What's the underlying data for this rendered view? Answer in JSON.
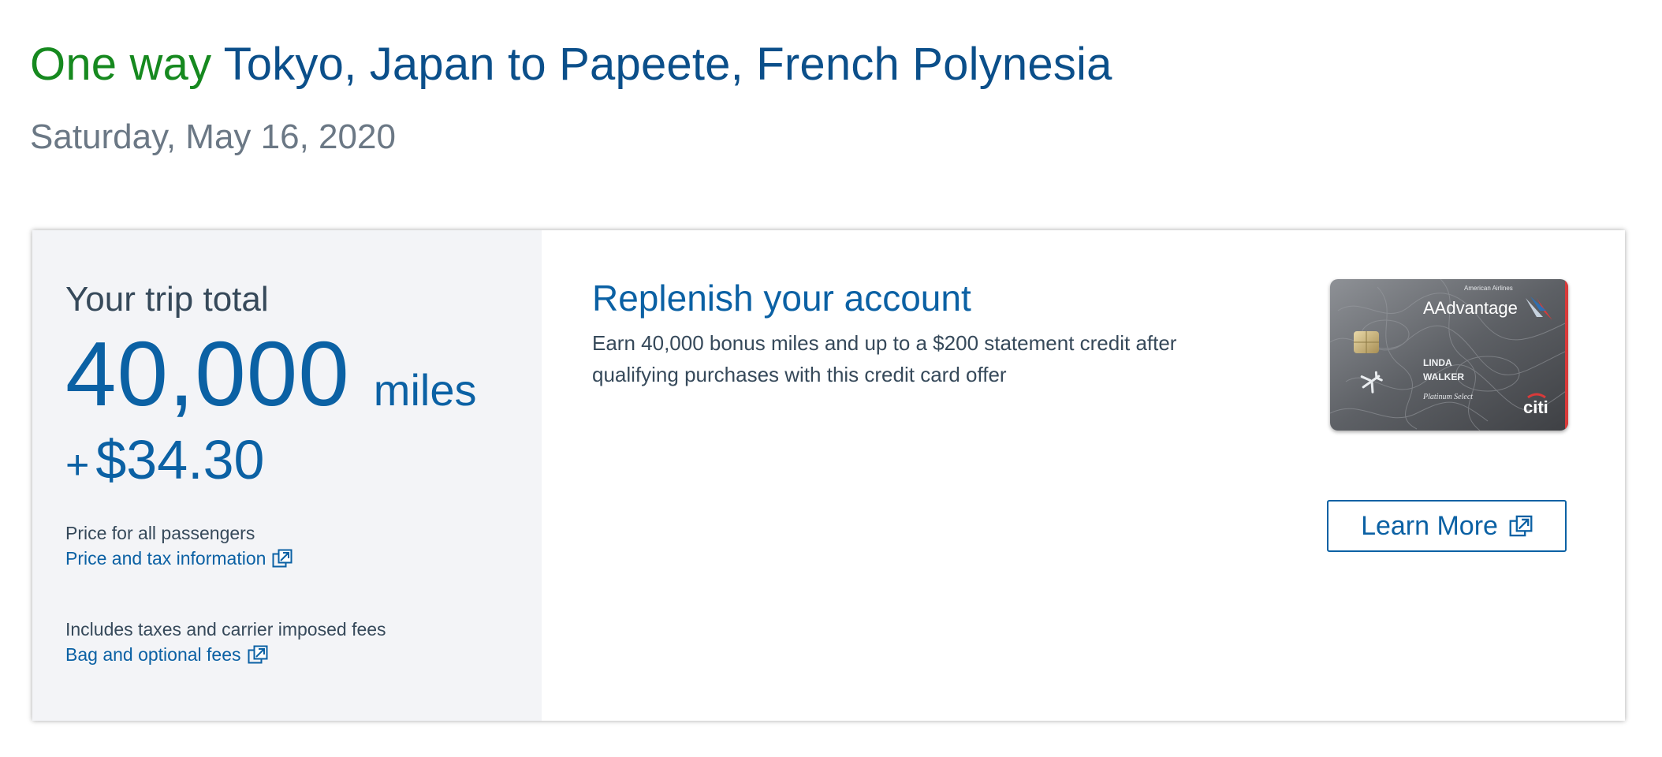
{
  "header": {
    "trip_type": "One way",
    "route": "Tokyo, Japan to Papeete, French Polynesia",
    "date": "Saturday, May 16, 2020"
  },
  "summary": {
    "label": "Your trip total",
    "miles_amount": "40,000",
    "miles_unit": "miles",
    "cash_plus": "+",
    "cash_amount": "$34.30",
    "passengers_note": "Price for all passengers",
    "price_tax_link": "Price and tax information",
    "taxes_note": "Includes taxes and carrier imposed fees",
    "bag_fees_link": "Bag and optional fees"
  },
  "promo": {
    "title": "Replenish your account",
    "text": "Earn 40,000 bonus miles and up to a $200 statement credit after qualifying purchases with this credit card offer",
    "learn_more_label": "Learn More",
    "card": {
      "issuer_small": "American Airlines",
      "program": "AAdvantage",
      "holder_first": "LINDA",
      "holder_last": "WALKER",
      "tier": "Platinum Select",
      "bank": "citi"
    }
  },
  "colors": {
    "brand_blue": "#0b61a4",
    "title_blue": "#0b4f8a",
    "trip_type_green": "#16891f",
    "panel_grey": "#f3f4f7"
  }
}
